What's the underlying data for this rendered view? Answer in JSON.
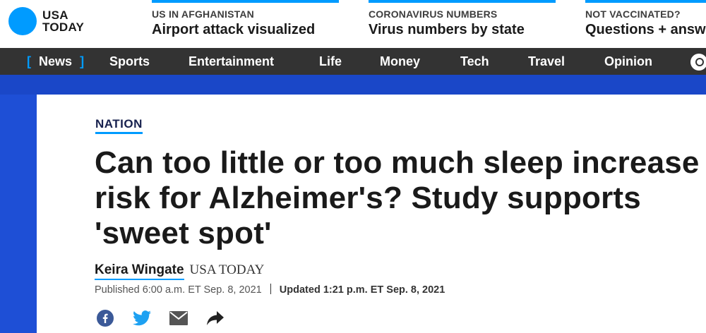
{
  "brand": {
    "line1": "USA",
    "line2": "TODAY"
  },
  "promos": [
    {
      "kicker": "US IN AFGHANISTAN",
      "title": "Airport attack visualized"
    },
    {
      "kicker": "CORONAVIRUS NUMBERS",
      "title": "Virus numbers by state"
    },
    {
      "kicker": "NOT VACCINATED?",
      "title": "Questions + answ"
    }
  ],
  "nav": {
    "items": [
      {
        "label": "News",
        "active": true
      },
      {
        "label": "Sports"
      },
      {
        "label": "Entertainment"
      },
      {
        "label": "Life"
      },
      {
        "label": "Money"
      },
      {
        "label": "Tech"
      },
      {
        "label": "Travel"
      },
      {
        "label": "Opinion"
      }
    ],
    "bracket_open": "[",
    "bracket_close": "]",
    "search_icon": "search-icon"
  },
  "article": {
    "section": "NATION",
    "headline": "Can too little or too much sleep increase risk for Alzheimer's? Study supports 'sweet spot'",
    "author": "Keira Wingate",
    "outlet": "USA TODAY",
    "published": "Published 6:00 a.m. ET Sep. 8, 2021",
    "updated": "Updated 1:21 p.m. ET Sep. 8, 2021",
    "share_icons": [
      "facebook-icon",
      "twitter-icon",
      "email-icon",
      "share-arrow-icon"
    ]
  },
  "colors": {
    "accent": "#009bff",
    "nav_bg": "#333333",
    "band": "#1e4fd6",
    "facebook": "#3b5998",
    "twitter": "#1da1f2"
  }
}
